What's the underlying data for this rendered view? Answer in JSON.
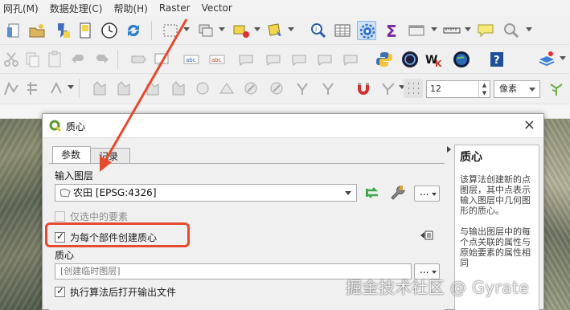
{
  "menubar": {
    "items": [
      "网孔(M)",
      "数据处理(C)",
      "帮助(H)",
      "Raster",
      "Vector"
    ]
  },
  "toolbar": {
    "row1_icons": [
      "new-project-icon",
      "open-icon",
      "save-icon",
      "layout-icon",
      "clock-icon",
      "refresh-icon",
      "digitize-icon",
      "toggle-edit-icon",
      "select-icon",
      "identify-icon",
      "attribute-table-icon",
      "settings-gear-icon",
      "sigma-icon",
      "measure-table-icon",
      "ruler-icon",
      "tooltip-icon",
      "search-icon"
    ],
    "row3_font_size": "12",
    "row3_unit": "像素"
  },
  "colors": {
    "accent_red": "#e44b2f",
    "qgis_green": "#589632",
    "highlight_blue": "#cfe3f7"
  },
  "dialog": {
    "title": "质心",
    "close_symbol": "×",
    "tabs": [
      {
        "label": "参数",
        "active": true
      },
      {
        "label": "记录",
        "active": false
      }
    ],
    "input_layer": {
      "label": "输入图层",
      "value": "农田 [EPSG:4326]",
      "more_label": "..."
    },
    "selected_only": {
      "label": "仅选中的要素",
      "checked": false,
      "enabled": false
    },
    "per_part": {
      "label": "为每个部件创建质心",
      "checked": true
    },
    "output": {
      "label": "质心",
      "placeholder": "[创建临时图层]",
      "more_label": "..."
    },
    "open_after": {
      "label": "执行算法后打开输出文件",
      "checked": true
    },
    "help": {
      "title": "质心",
      "para1": "该算法创建新的点图层，其中点表示输入图层中几何图形的质心。",
      "para2": "与输出图层中的每个点关联的属性与原始要素的属性相同"
    }
  },
  "watermark": "掘金技术社区 @ Gyrate"
}
